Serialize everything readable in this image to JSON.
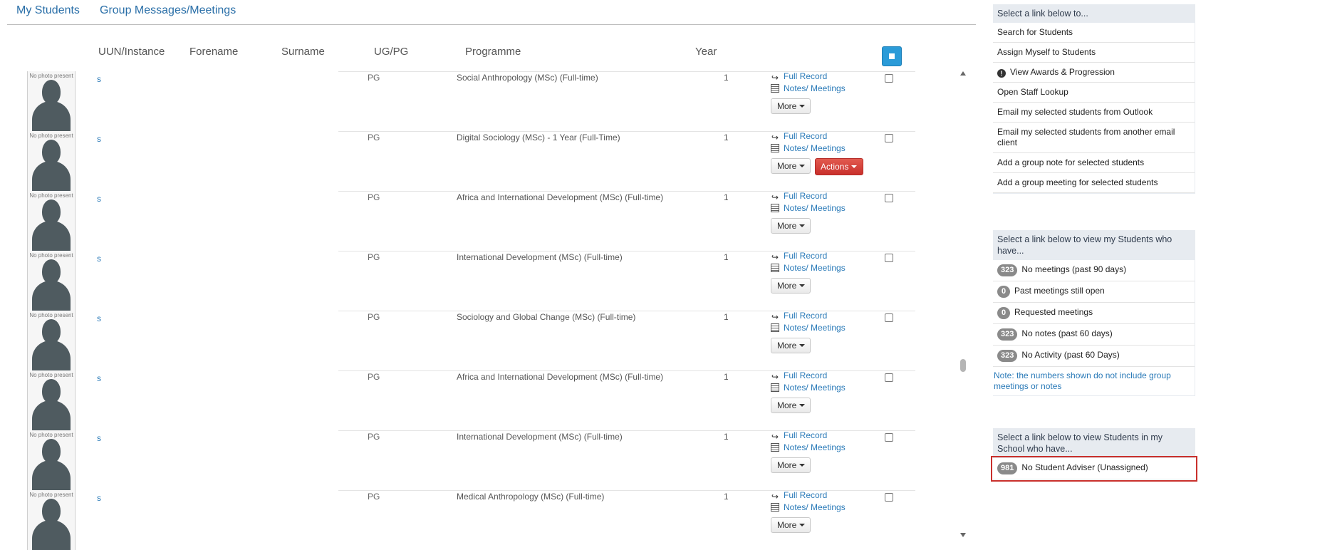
{
  "tabs": [
    "My Students",
    "Group Messages/Meetings"
  ],
  "table": {
    "columns": [
      "UUN/Instance",
      "Forename",
      "Surname",
      "UG/PG",
      "Programme",
      "Year"
    ],
    "photo_caption": "No photo present",
    "full_record_label": "Full Record",
    "notes_label": "Notes/ Meetings",
    "more_label": "More",
    "actions_label": "Actions",
    "rows": [
      {
        "uun": "s",
        "level": "PG",
        "programme": "Social Anthropology (MSc) (Full-time)",
        "year": "1"
      },
      {
        "uun": "s",
        "level": "PG",
        "programme": "Digital Sociology (MSc) - 1 Year (Full-Time)",
        "year": "1"
      },
      {
        "uun": "s",
        "level": "PG",
        "programme": "Africa and International Development (MSc) (Full-time)",
        "year": "1"
      },
      {
        "uun": "s",
        "level": "PG",
        "programme": "International Development (MSc) (Full-time)",
        "year": "1"
      },
      {
        "uun": "s",
        "level": "PG",
        "programme": "Sociology and Global Change (MSc) (Full-time)",
        "year": "1"
      },
      {
        "uun": "s",
        "level": "PG",
        "programme": "Africa and International Development (MSc) (Full-time)",
        "year": "1"
      },
      {
        "uun": "s",
        "level": "PG",
        "programme": "International Development (MSc) (Full-time)",
        "year": "1"
      },
      {
        "uun": "s",
        "level": "PG",
        "programme": "Medical Anthropology (MSc) (Full-time)",
        "year": "1"
      }
    ]
  },
  "panel_links": {
    "header": "Select a link below to...",
    "items": [
      "Search for Students",
      "Assign Myself to Students",
      "View Awards & Progression",
      "Open Staff Lookup",
      "Email my selected students from Outlook",
      "Email my selected students from another email client",
      "Add a group note for selected students",
      "Add a group meeting for selected students"
    ]
  },
  "panel_my_students": {
    "header": "Select a link below to view my Students who have...",
    "items": [
      {
        "count": "323",
        "label": "No meetings (past 90 days)"
      },
      {
        "count": "0",
        "label": "Past meetings still open"
      },
      {
        "count": "0",
        "label": "Requested meetings"
      },
      {
        "count": "323",
        "label": "No notes (past 60 days)"
      },
      {
        "count": "323",
        "label": "No Activity (past 60 Days)"
      }
    ],
    "note": "Note: the numbers shown do not include group meetings or notes"
  },
  "panel_school": {
    "header": "Select a link below to view Students in my School who have...",
    "items": [
      {
        "count": "981",
        "label": "No Student Adviser (Unassigned)"
      }
    ]
  },
  "colors": {
    "link": "#2a7ab8",
    "actions": "#c9302c",
    "select_all": "#2b9bd8",
    "badge": "#8a8a8a"
  },
  "icons": [
    "full-record-icon",
    "notes-icon",
    "warning-icon"
  ]
}
